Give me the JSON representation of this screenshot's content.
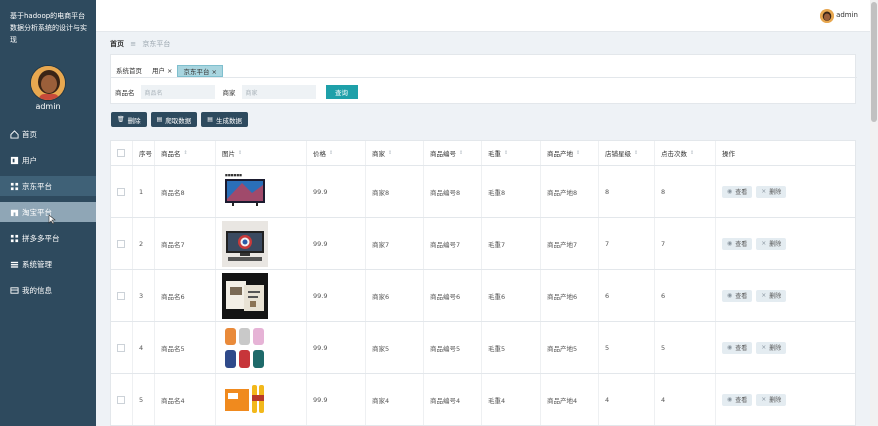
{
  "sidebar": {
    "system_title": "基于hadoop的电商平台数据分析系统的设计与实现",
    "username": "admin",
    "items": [
      {
        "label": "首页",
        "icon": "home-icon"
      },
      {
        "label": "用户",
        "icon": "user-book-icon"
      },
      {
        "label": "京东平台",
        "icon": "grid-icon"
      },
      {
        "label": "淘宝平台",
        "icon": "shop-icon"
      },
      {
        "label": "拼多多平台",
        "icon": "grid-icon"
      },
      {
        "label": "系统管理",
        "icon": "list-icon"
      },
      {
        "label": "我的信息",
        "icon": "card-icon"
      }
    ]
  },
  "topbar": {
    "username": "admin"
  },
  "breadcrumb": {
    "home": "首页",
    "separator": "≡",
    "current": "京东平台"
  },
  "tabs": [
    {
      "label": "系统首页",
      "closable": false
    },
    {
      "label": "用户",
      "closable": true
    },
    {
      "label": "京东平台",
      "closable": true
    }
  ],
  "search": {
    "name_label": "商品名",
    "name_placeholder": "商品名",
    "shop_label": "商家",
    "shop_placeholder": "商家",
    "button": "查询"
  },
  "actions": {
    "delete": "删除",
    "crawl": "爬取数据",
    "generate": "生成数据"
  },
  "table": {
    "columns": [
      "序号",
      "商品名",
      "图片",
      "价格",
      "商家",
      "商品编号",
      "毛重",
      "商品产地",
      "店铺星级",
      "点击次数",
      "操作"
    ],
    "view_label": "查看",
    "delete_label": "删除",
    "rows": [
      {
        "no": "1",
        "name": "商品名8",
        "price": "99.9",
        "shop": "商家8",
        "code": "商品编号8",
        "weight": "毛重8",
        "origin": "商品产地8",
        "stars": "8",
        "clicks": "8"
      },
      {
        "no": "2",
        "name": "商品名7",
        "price": "99.9",
        "shop": "商家7",
        "code": "商品编号7",
        "weight": "毛重7",
        "origin": "商品产地7",
        "stars": "7",
        "clicks": "7"
      },
      {
        "no": "3",
        "name": "商品名6",
        "price": "99.9",
        "shop": "商家6",
        "code": "商品编号6",
        "weight": "毛重6",
        "origin": "商品产地6",
        "stars": "6",
        "clicks": "6"
      },
      {
        "no": "4",
        "name": "商品名5",
        "price": "99.9",
        "shop": "商家5",
        "code": "商品编号5",
        "weight": "毛重5",
        "origin": "商品产地5",
        "stars": "5",
        "clicks": "5"
      },
      {
        "no": "5",
        "name": "商品名4",
        "price": "99.9",
        "shop": "商家4",
        "code": "商品编号4",
        "weight": "毛重4",
        "origin": "商品产地4",
        "stars": "4",
        "clicks": "4"
      }
    ]
  },
  "colors": {
    "sidebar": "#2e4a5e",
    "accent": "#1ea0a9",
    "tab_active": "#a8d5df"
  }
}
